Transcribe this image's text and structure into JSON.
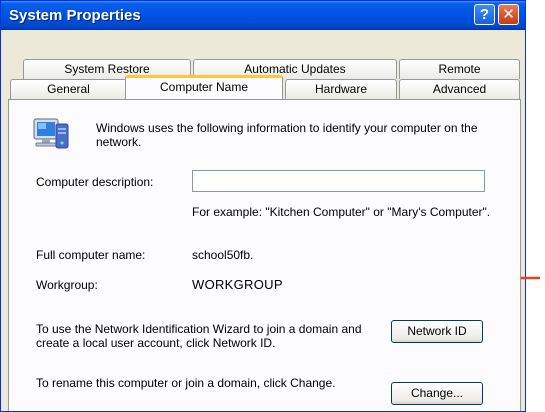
{
  "window": {
    "title": "System Properties",
    "help_glyph": "?",
    "close_glyph": "✕"
  },
  "tabs": {
    "row1": [
      "System Restore",
      "Automatic Updates",
      "Remote"
    ],
    "row2": [
      "General",
      "Computer Name",
      "Hardware",
      "Advanced"
    ],
    "active": "Computer Name"
  },
  "content": {
    "intro": "Windows uses the following information to identify your computer on the network.",
    "description_label": "Computer description:",
    "description_value": "",
    "example_text": "For example: \"Kitchen Computer\" or \"Mary's Computer\".",
    "full_name_label": "Full computer name:",
    "full_name_value": "school50fb.",
    "workgroup_label": "Workgroup:",
    "workgroup_value": "WORKGROUP",
    "network_id_text": "To use the Network Identification Wizard to join a domain and create a local user account, click Network ID.",
    "network_id_button": "Network ID",
    "rename_text": "To rename this computer or join a domain, click Change.",
    "change_button": "Change..."
  },
  "annotation": {
    "arrow_color": "#e8421c",
    "points_to": "workgroup-value"
  },
  "icons": {
    "computer": "computer-icon",
    "help": "help-icon",
    "close": "close-icon"
  }
}
